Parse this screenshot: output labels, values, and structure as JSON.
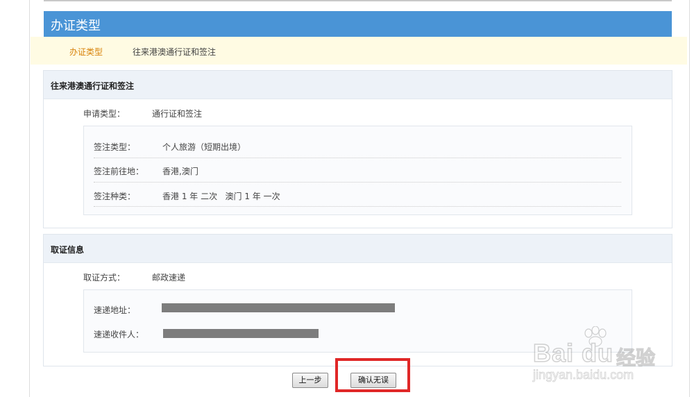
{
  "section_title": "办证类型",
  "breadcrumb": {
    "active": "办证类型",
    "item": "往来港澳通行证和签注"
  },
  "permit_panel": {
    "title": "往来港澳通行证和签注",
    "apply_type_label": "申请类型：",
    "apply_type_value": "通行证和签注",
    "endorsement": {
      "type_label": "签注类型：",
      "type_value": "个人旅游（短期出境）",
      "destination_label": "签注前往地：",
      "destination_value": "香港,澳门",
      "kind_label": "签注种类：",
      "kind_value": "香港 1 年 二次   澳门 1 年 一次"
    }
  },
  "pickup_panel": {
    "title": "取证信息",
    "method_label": "取证方式：",
    "method_value": "邮政速递",
    "address_label": "速递地址：",
    "recipient_label": "速递收件人："
  },
  "actions": {
    "prev_label": "上一步",
    "confirm_label": "确认无误"
  },
  "watermark": {
    "logo": "Bai du",
    "cn": "经验",
    "url": "jingyan.baidu.com"
  },
  "colors": {
    "title_bar": "#4a94d6",
    "crumb_active": "#d8830b",
    "highlight": "#e02727"
  }
}
